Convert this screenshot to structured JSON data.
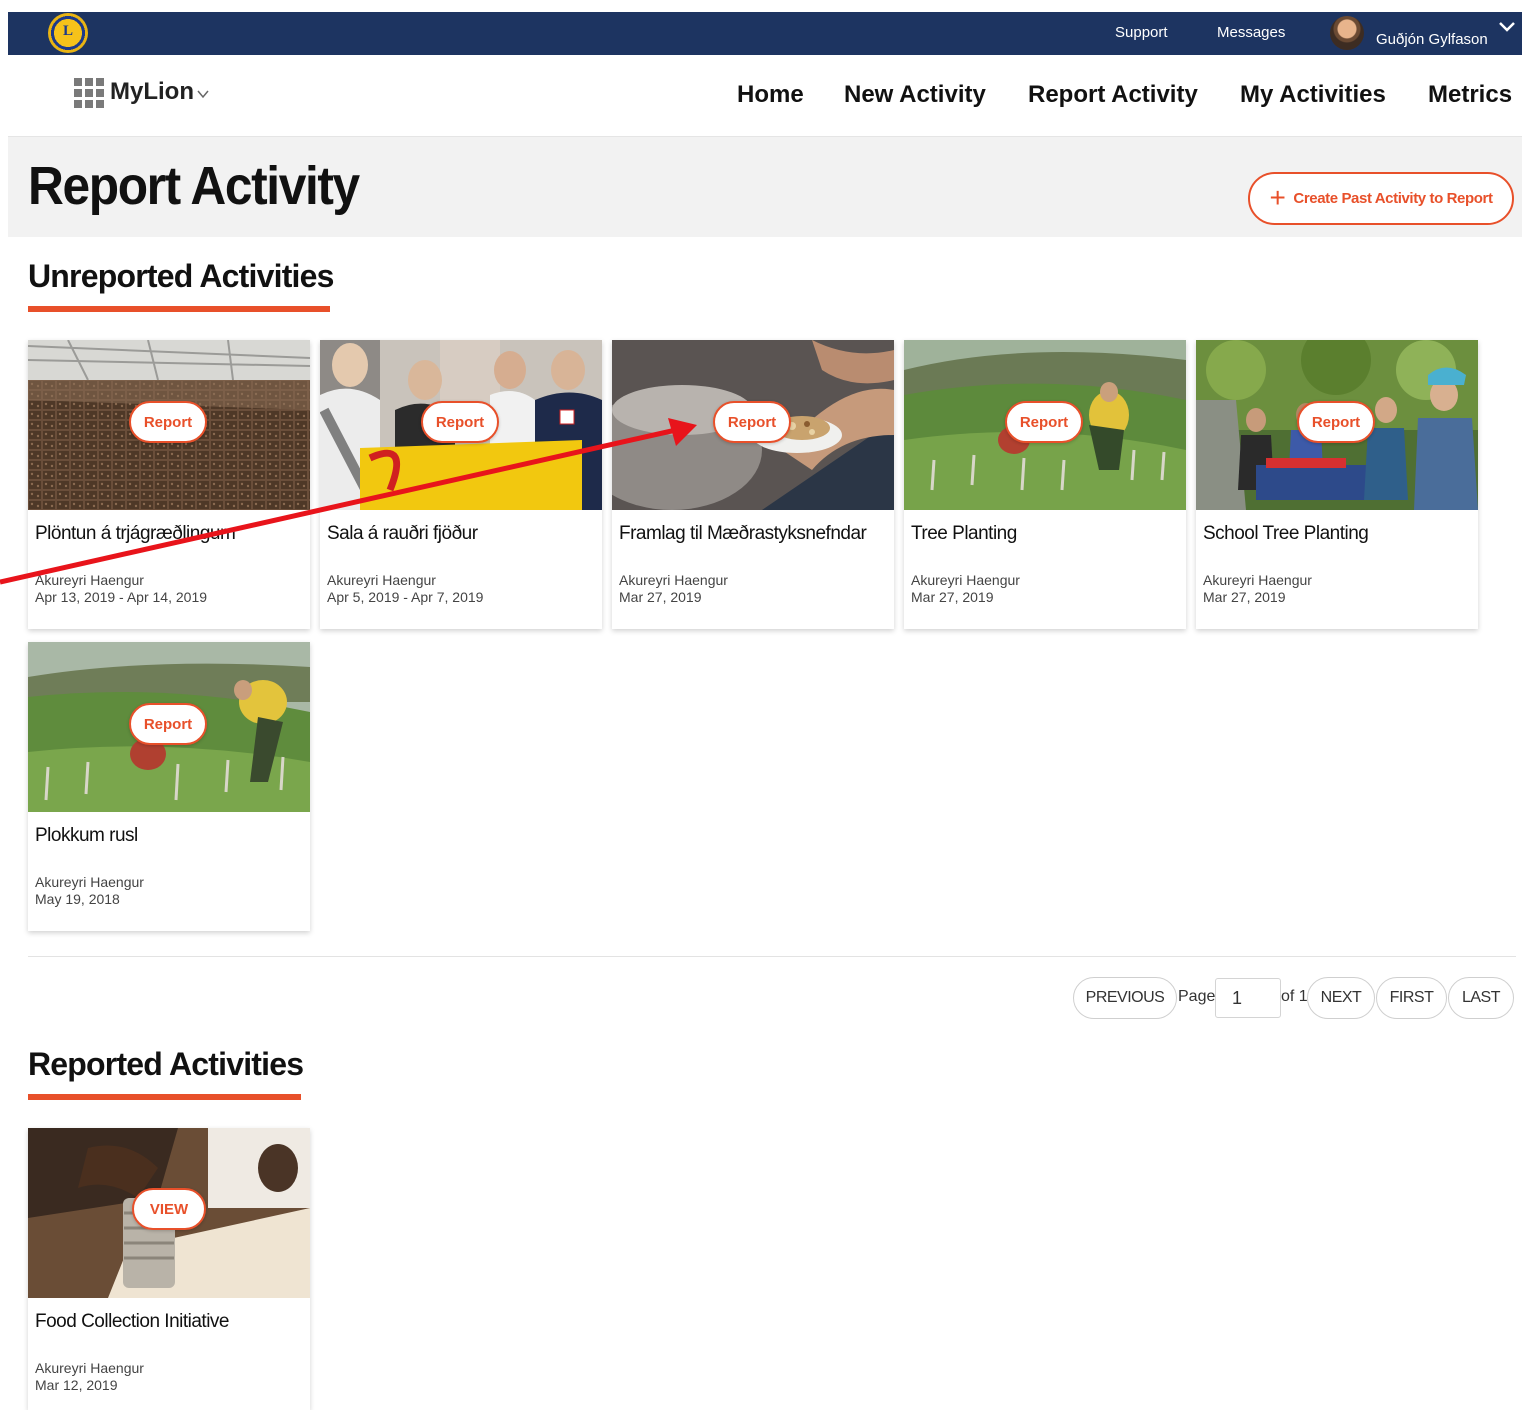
{
  "topbar": {
    "logo_letter": "L",
    "support": "Support",
    "messages": "Messages",
    "user_name": "Guðjón Gylfason"
  },
  "nav": {
    "brand": "MyLion",
    "items": [
      "Home",
      "New Activity",
      "Report Activity",
      "My Activities",
      "Metrics"
    ]
  },
  "header": {
    "title": "Report Activity",
    "create_button": "Create Past Activity to Report"
  },
  "unreported": {
    "title": "Unreported Activities",
    "cards": [
      {
        "title": "Plöntun á trjágræðlingum",
        "club": "Akureyri Haengur",
        "date": "Apr 13, 2019 - Apr 14, 2019",
        "action": "Report"
      },
      {
        "title": "Sala á rauðri fjöður",
        "club": "Akureyri Haengur",
        "date": "Apr 5, 2019 - Apr 7, 2019",
        "action": "Report"
      },
      {
        "title": "Framlag til Mæðrastyksnefndar",
        "club": "Akureyri Haengur",
        "date": "Mar 27, 2019",
        "action": "Report"
      },
      {
        "title": "Tree Planting",
        "club": "Akureyri Haengur",
        "date": "Mar 27, 2019",
        "action": "Report"
      },
      {
        "title": "School Tree Planting",
        "club": "Akureyri Haengur",
        "date": "Mar 27, 2019",
        "action": "Report"
      },
      {
        "title": "Plokkum rusl",
        "club": "Akureyri Haengur",
        "date": "May 19, 2018",
        "action": "Report"
      }
    ]
  },
  "pagination": {
    "previous": "PREVIOUS",
    "page_label": "Page",
    "page_value": "1",
    "of_label": "of 1",
    "next": "NEXT",
    "first": "FIRST",
    "last": "LAST"
  },
  "reported": {
    "title": "Reported Activities",
    "cards": [
      {
        "title": "Food Collection Initiative",
        "club": "Akureyri Haengur",
        "date": "Mar 12, 2019",
        "action": "VIEW"
      }
    ]
  },
  "colors": {
    "navy": "#1d3461",
    "accent": "#e8502a",
    "annotation": "#e8141b"
  }
}
